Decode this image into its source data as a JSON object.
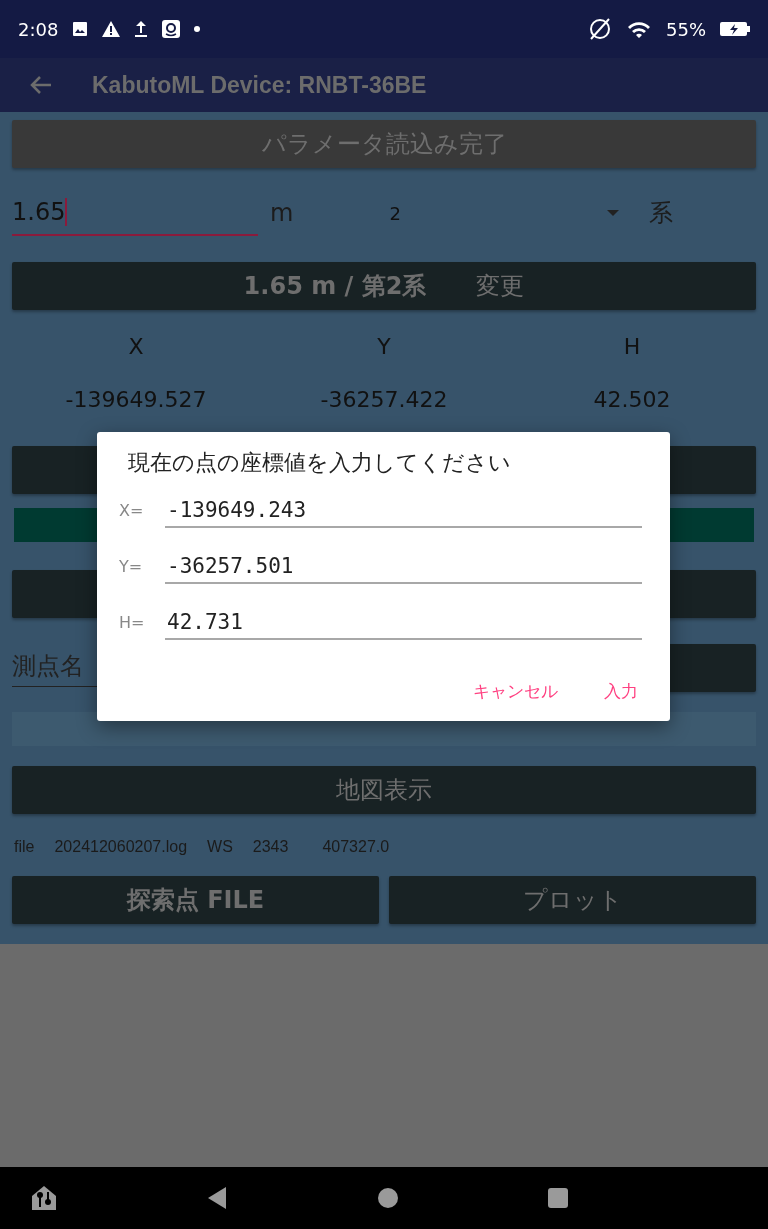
{
  "status_bar": {
    "time": "2:08",
    "battery": "55%"
  },
  "app_bar": {
    "title": "KabutoML Device: RNBT-36BE"
  },
  "load_button": {
    "label": "パラメータ読込み完了",
    "disabled": true
  },
  "height_field": {
    "value": "1.65",
    "unit": "m",
    "focused": true
  },
  "zone_select": {
    "value": "2",
    "unit": "系"
  },
  "change_button": {
    "label": "1.65 m / 第2系",
    "action": "変更"
  },
  "coords": {
    "columns": [
      "X",
      "Y",
      "H"
    ],
    "values": [
      "-139649.527",
      "-36257.422",
      "42.502"
    ]
  },
  "point_name_field": {
    "placeholder": "測点名"
  },
  "map_button": {
    "label": "地図表示"
  },
  "file_info": [
    "file",
    "202412060207.log",
    "WS",
    "2343",
    "407327.0"
  ],
  "bottom_buttons": [
    {
      "label": "探索点 FILE"
    },
    {
      "label": "プロット"
    }
  ],
  "dialog": {
    "title": "現在の点の座標値を入力してください",
    "fields": [
      {
        "label": "X=",
        "value": "-139649.243"
      },
      {
        "label": "Y=",
        "value": "-36257.501"
      },
      {
        "label": "H=",
        "value": "42.731"
      }
    ],
    "buttons": [
      "キャンセル",
      "入力"
    ]
  }
}
